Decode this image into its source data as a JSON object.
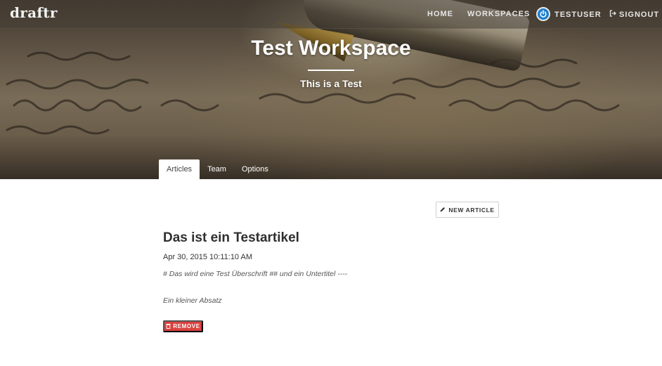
{
  "navbar": {
    "brand": "draftr",
    "links": {
      "home": "HOME",
      "workspaces": "WORKSPACES",
      "user": "TESTUSER",
      "signout": "SIGNOUT"
    },
    "icons": {
      "user": "power-icon",
      "signout": "sign-out-icon"
    },
    "user_accent": "#1e7fd0"
  },
  "hero": {
    "title": "Test Workspace",
    "subtitle": "This is a Test"
  },
  "tabs": [
    {
      "label": "Articles",
      "active": true
    },
    {
      "label": "Team",
      "active": false
    },
    {
      "label": "Options",
      "active": false
    }
  ],
  "toolbar": {
    "new_article_label": "NEW ARTICLE",
    "new_article_icon": "pencil-icon"
  },
  "article": {
    "title": "Das ist ein Testartikel",
    "date": "Apr 30, 2015 10:11:10 AM",
    "lines": [
      "# Das wird eine Test Überschrift ## und ein Untertitel ----",
      "Ein kleiner Absatz"
    ],
    "remove_label": "REMOVE",
    "remove_icon": "trash-icon",
    "remove_color": "#d9423f"
  }
}
